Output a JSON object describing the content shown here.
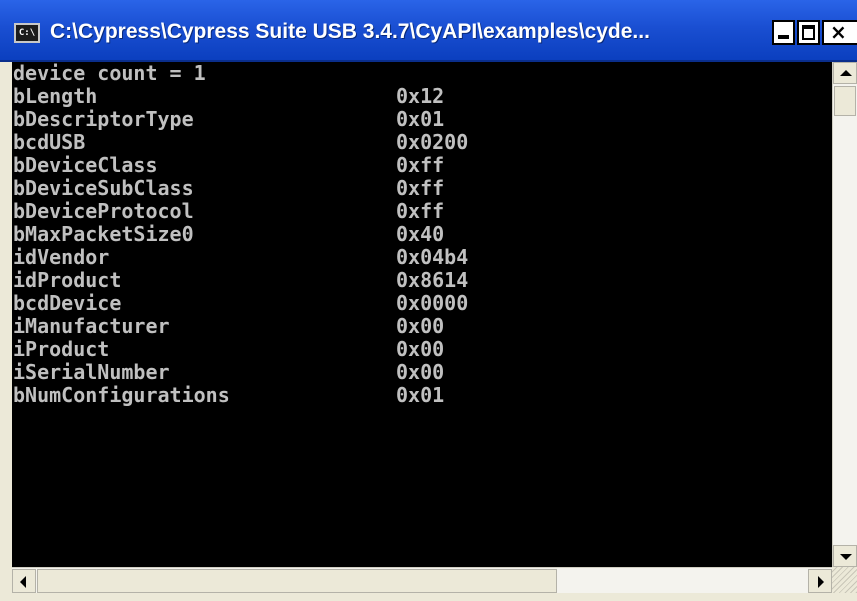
{
  "window": {
    "title": "C:\\Cypress\\Cypress Suite USB 3.4.7\\CyAPI\\examples\\cyde...",
    "icon_text": "C:\\",
    "controls": {
      "minimize": "minimize",
      "maximize": "maximize",
      "close": "×"
    }
  },
  "console": {
    "header": "device count = 1",
    "fields": [
      {
        "name": "bLength",
        "value": "0x12"
      },
      {
        "name": "bDescriptorType",
        "value": "0x01"
      },
      {
        "name": "bcdUSB",
        "value": "0x0200"
      },
      {
        "name": "bDeviceClass",
        "value": "0xff"
      },
      {
        "name": "bDeviceSubClass",
        "value": "0xff"
      },
      {
        "name": "bDeviceProtocol",
        "value": "0xff"
      },
      {
        "name": "bMaxPacketSize0",
        "value": "0x40"
      },
      {
        "name": "idVendor",
        "value": "0x04b4"
      },
      {
        "name": "idProduct",
        "value": "0x8614"
      },
      {
        "name": "bcdDevice",
        "value": "0x0000"
      },
      {
        "name": "iManufacturer",
        "value": "0x00"
      },
      {
        "name": "iProduct",
        "value": "0x00"
      },
      {
        "name": "iSerialNumber",
        "value": "0x00"
      },
      {
        "name": "bNumConfigurations",
        "value": "0x01"
      }
    ]
  },
  "colors": {
    "console_background": "#000000",
    "console_text": "#c0c0c0",
    "titlebar": "#1a4fd2"
  }
}
